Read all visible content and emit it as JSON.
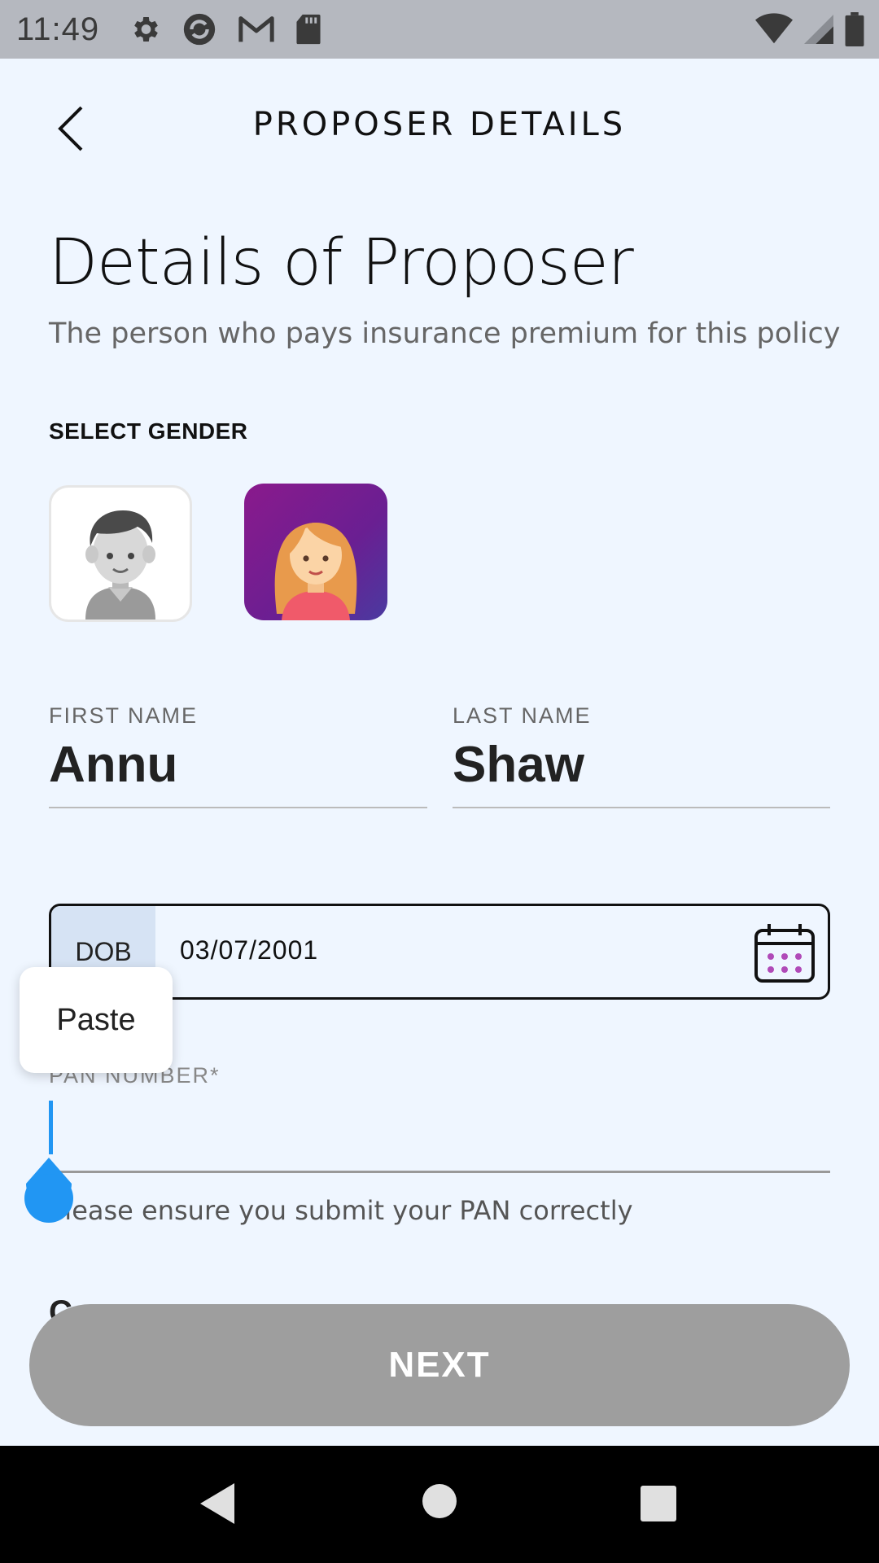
{
  "status_bar": {
    "time": "11:49",
    "icons_left": [
      "gear-icon",
      "sync-icon",
      "gmail-icon",
      "sd-card-icon"
    ],
    "icons_right": [
      "wifi-icon",
      "signal-icon",
      "battery-icon"
    ]
  },
  "app_bar": {
    "title": "PROPOSER DETAILS",
    "back_icon": "chevron-left-icon"
  },
  "header": {
    "title": "Details of Proposer",
    "subtitle": "The person who pays insurance premium for this policy"
  },
  "gender": {
    "label": "SELECT GENDER",
    "options": [
      {
        "name": "male",
        "selected": false
      },
      {
        "name": "female",
        "selected": true
      }
    ],
    "selected_color": "#8a1a8c"
  },
  "form": {
    "first_name": {
      "label": "FIRST NAME",
      "value": "Annu"
    },
    "last_name": {
      "label": "LAST NAME",
      "value": "Shaw"
    },
    "dob": {
      "label": "DOB",
      "value": "03/07/2001"
    },
    "pan": {
      "label": "PAN NUMBER*",
      "value": "",
      "helper": "Please ensure you submit your PAN correctly"
    },
    "next_section_partial": "C"
  },
  "context_menu": {
    "paste_label": "Paste"
  },
  "actions": {
    "next_label": "NEXT"
  },
  "colors": {
    "background": "#eff6ff",
    "next_button": "#9e9e9e",
    "cursor": "#2196f3",
    "calendar_dots": "#b04ab8"
  }
}
